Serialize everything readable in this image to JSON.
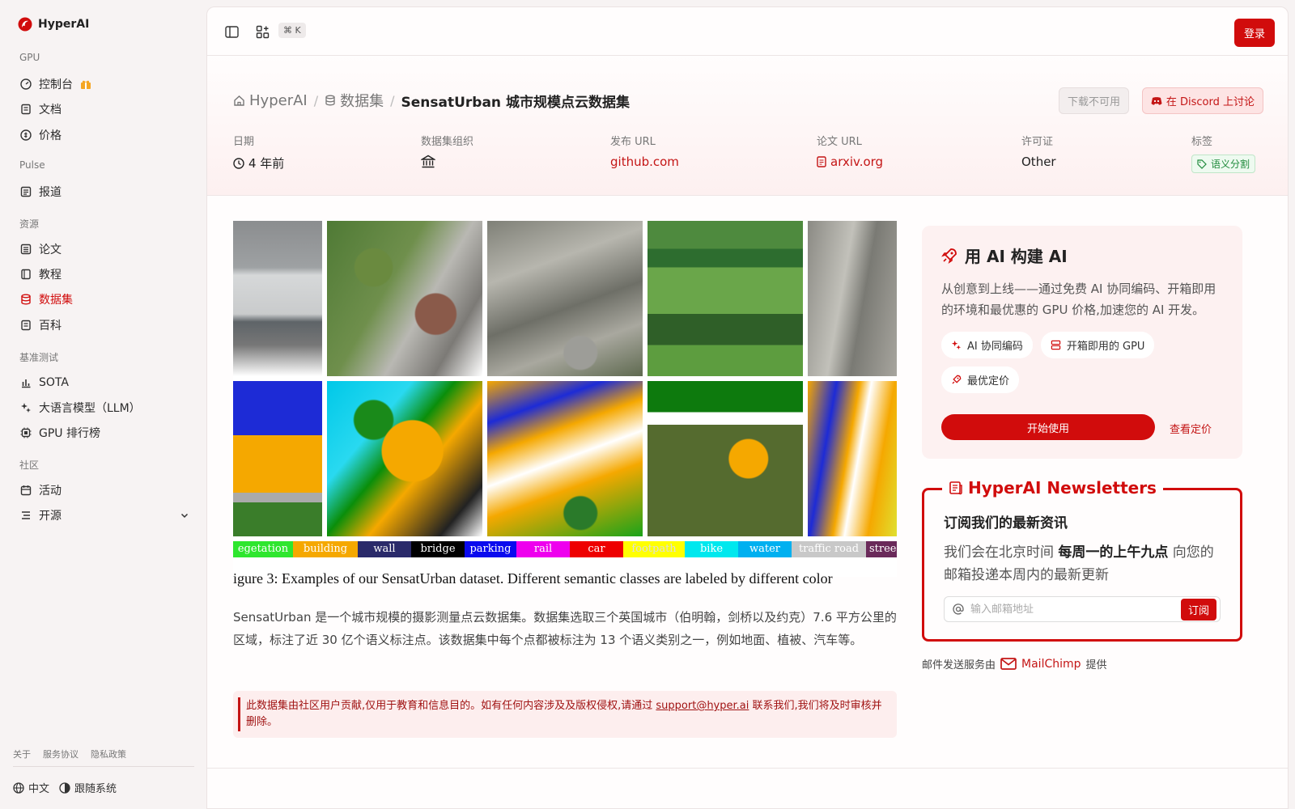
{
  "brand": {
    "name": "HyperAI"
  },
  "sidebar": {
    "sections": [
      {
        "title": "GPU",
        "items": [
          {
            "label": "控制台",
            "icon": "dashboard-icon"
          },
          {
            "label": "文档",
            "icon": "doc-icon"
          },
          {
            "label": "价格",
            "icon": "price-icon"
          }
        ]
      },
      {
        "title": "Pulse",
        "items": [
          {
            "label": "报道",
            "icon": "news-icon"
          }
        ]
      },
      {
        "title": "资源",
        "items": [
          {
            "label": "论文",
            "icon": "paper-icon"
          },
          {
            "label": "教程",
            "icon": "tutorial-icon"
          },
          {
            "label": "数据集",
            "icon": "database-icon",
            "active": true
          },
          {
            "label": "百科",
            "icon": "wiki-icon"
          }
        ]
      },
      {
        "title": "基准测试",
        "items": [
          {
            "label": "SOTA",
            "icon": "chart-icon"
          },
          {
            "label": "大语言模型（LLM）",
            "icon": "sparkle-icon"
          },
          {
            "label": "GPU 排行榜",
            "icon": "cpu-icon"
          }
        ]
      },
      {
        "title": "社区",
        "items": [
          {
            "label": "活动",
            "icon": "calendar-icon"
          },
          {
            "label": "开源",
            "icon": "list-icon"
          }
        ]
      }
    ],
    "footer": {
      "about": "关于",
      "terms": "服务协议",
      "privacy": "隐私政策"
    },
    "language": "中文",
    "theme": "跟随系统"
  },
  "topbar": {
    "shortcut": "⌘ K",
    "login": "登录"
  },
  "breadcrumb": {
    "home": "HyperAI",
    "datasets": "数据集",
    "current": "SensatUrban 城市规模点云数据集"
  },
  "actions": {
    "download": "下载不可用",
    "discord": "在 Discord 上讨论"
  },
  "meta": {
    "date_label": "日期",
    "date_value": "4 年前",
    "org_label": "数据集组织",
    "release_label": "发布 URL",
    "release_value": "github.com",
    "paper_label": "论文 URL",
    "paper_value": "arxiv.org",
    "license_label": "许可证",
    "license_value": "Other",
    "tags_label": "标签",
    "tag_value": "语义分割"
  },
  "figure": {
    "legend": [
      "egetation",
      "building",
      "wall",
      "bridge",
      "parking",
      "rail",
      "car",
      "footpath",
      "bike",
      "water",
      "traffic road",
      "stree"
    ],
    "caption": "igure 3: Examples of our SensatUrban dataset. Different semantic classes are labeled by different color"
  },
  "description": "SensatUrban 是一个城市规模的摄影测量点云数据集。数据集选取三个英国城市（伯明翰，剑桥以及约克）7.6 平方公里的区域，标注了近 30 亿个语义标注点。该数据集中每个点都被标注为 13 个语义类别之一，例如地面、植被、汽车等。",
  "notice": {
    "text_before": "此数据集由社区用户贡献,仅用于教育和信息目的。如有任何内容涉及及版权侵权,请通过 ",
    "email": "support@hyper.ai",
    "text_after": " 联系我们,我们将及时审核并删除。"
  },
  "ai_card": {
    "title": "用 AI 构建 AI",
    "desc": "从创意到上线——通过免费 AI 协同编码、开箱即用的环境和最优惠的 GPU 价格,加速您的 AI 开发。",
    "chips": [
      "AI 协同编码",
      "开箱即用的 GPU",
      "最优定价"
    ],
    "start": "开始使用",
    "pricing": "查看定价"
  },
  "newsletter": {
    "title": "HyperAI Newsletters",
    "subtitle": "订阅我们的最新资讯",
    "desc_before": "我们会在北京时间 ",
    "desc_bold": "每周一的上午九点",
    "desc_after": " 向您的邮箱投递本周内的最新更新",
    "placeholder": "输入邮箱地址",
    "subscribe": "订阅"
  },
  "mail_note": {
    "before": "邮件发送服务由",
    "provider": "MailChimp",
    "after": "提供"
  },
  "colors": {
    "accent": "#d10c0c",
    "accent_light": "#fdf1f1",
    "tag_green": "#1f8a3b"
  }
}
